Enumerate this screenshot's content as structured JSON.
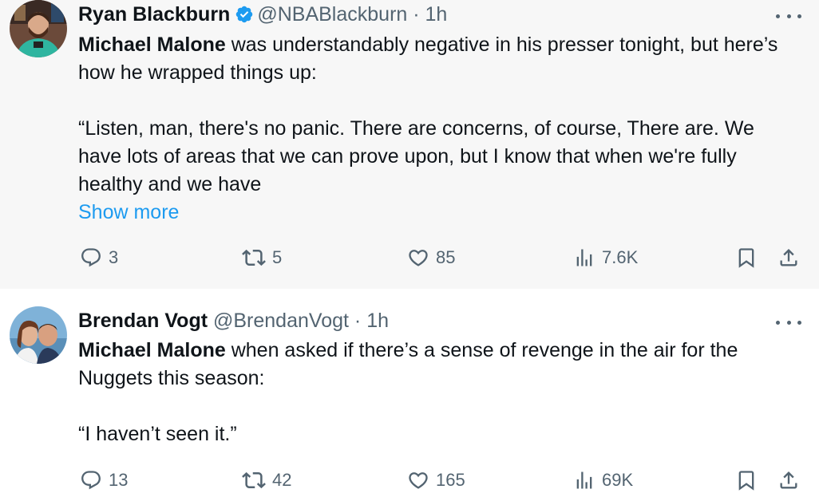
{
  "tweets": [
    {
      "author": {
        "name": "Ryan Blackburn",
        "handle": "@NBABlackburn",
        "verified": true
      },
      "separator": "·",
      "time": "1h",
      "body": {
        "line1_bold": "Michael Malone",
        "line1_rest": " was understandably negative in his presser tonight, but here’s how he wrapped things up:",
        "quote": "“Listen, man, there's no panic. There are concerns, of course, There are. We have lots of areas that we can prove upon, but I know that when we're fully healthy and we have",
        "show_more": "Show more"
      },
      "stats": {
        "replies": "3",
        "retweets": "5",
        "likes": "85",
        "views": "7.6K"
      }
    },
    {
      "author": {
        "name": "Brendan Vogt",
        "handle": "@BrendanVogt",
        "verified": false
      },
      "separator": "·",
      "time": "1h",
      "body": {
        "line1_bold": "Michael Malone",
        "line1_rest": " when asked if there’s a sense of revenge in the air for the Nuggets this season:",
        "quote": "“I haven’t seen it.”"
      },
      "stats": {
        "replies": "13",
        "retweets": "42",
        "likes": "165",
        "views": "69K"
      }
    }
  ],
  "colors": {
    "verified": "#1d9bf0",
    "link": "#1d9bf0",
    "muted": "#536471",
    "text": "#0f1419"
  },
  "icons": [
    "verified-badge-icon",
    "more-options-icon",
    "reply-icon",
    "retweet-icon",
    "like-icon",
    "views-icon",
    "bookmark-icon",
    "share-icon"
  ]
}
